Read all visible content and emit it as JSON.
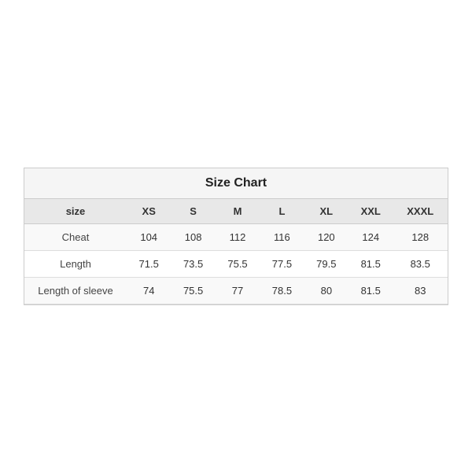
{
  "chart": {
    "title": "Size Chart",
    "columns": {
      "label": "size",
      "sizes": [
        "XS",
        "S",
        "M",
        "L",
        "XL",
        "XXL",
        "XXXL"
      ]
    },
    "rows": [
      {
        "label": "Cheat",
        "values": [
          "104",
          "108",
          "112",
          "116",
          "120",
          "124",
          "128"
        ]
      },
      {
        "label": "Length",
        "values": [
          "71.5",
          "73.5",
          "75.5",
          "77.5",
          "79.5",
          "81.5",
          "83.5"
        ]
      },
      {
        "label": "Length of sleeve",
        "values": [
          "74",
          "75.5",
          "77",
          "78.5",
          "80",
          "81.5",
          "83"
        ]
      }
    ]
  }
}
